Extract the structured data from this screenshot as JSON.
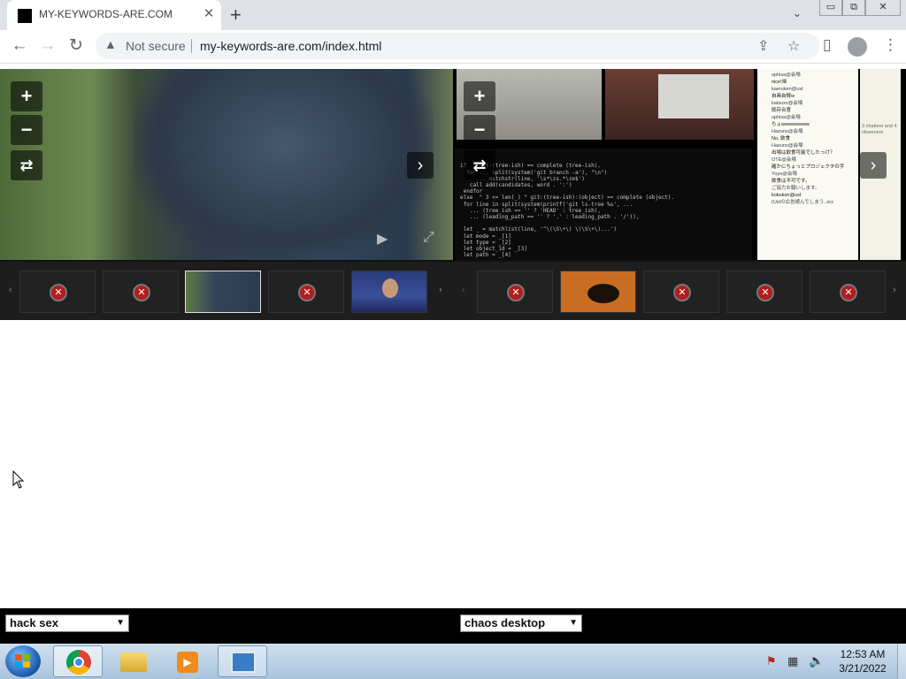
{
  "browser": {
    "tab_title": "MY-KEYWORDS-ARE.COM",
    "tab_close": "✕",
    "new_tab": "+",
    "window_minimize": "▭",
    "window_restore": "⧉",
    "window_close": "✕",
    "tab_search": "⌄",
    "back": "←",
    "forward": "→",
    "reload": "↻",
    "security_icon": "▲",
    "security_label": "Not secure",
    "url": "my-keywords-are.com/index.html",
    "share_icon": "⇪",
    "bookmark_icon": "☆",
    "sidepanel_icon": "▯",
    "menu_icon": "⋮"
  },
  "viewer": {
    "zoom_in": "+",
    "zoom_out": "−",
    "rotate": "⇄",
    "next": "›",
    "play": "▶",
    "fullscreen": "⤢",
    "strip_prev": "‹",
    "strip_next": "›",
    "thumb_error": "✕",
    "chat_header": "3 chatters and 4 observers",
    "chat_lines": [
      "uphisa@会場",
      "nice!帰",
      "kaeruken@ust",
      "自画自賛w",
      "katsuxx@会場",
      "既存合意",
      "uphisa@会場",
      "ちょwwwwwwww",
      "Hazuno@会場",
      "No, 飲食",
      "Hazuno@会場",
      "出場は飲食可能でしたっけ？",
      "OTE@会場",
      "確かにちょっとプロジェクタの字",
      "Yuyo@会場",
      "飲食は不可です。",
      "ご協力お願いします。",
      "kokukon@ust",
      "(Ustの広告読んでしまう..orz"
    ],
    "code_lines": [
      "if  \" git:(tree-ish) == complete (tree-ish).",
      "  for ... split(system('git branch -a'), \"\\n\")",
      "     ... matchstr(line, '\\s*\\zs.*\\ze$')",
      "   call add(candidates, word . ':')",
      " endfor",
      "else  \" 3 <= len(_) \" git:(tree-ish):(object) == complete (object).",
      " for line in split(system(printf('git ls-tree %s', ...",
      "   ... (tree_ish == '' ? 'HEAD' : tree_ish),",
      "   ... (leading_path == '' ? '.' : leading_path . '/')),",
      "",
      " let _ = matchlist(line, '^\\(\\S\\+\\) \\(\\S\\+\\)...')",
      " let mode = _[1]",
      " let type = _[2]",
      " let object_id = _[3]",
      " let path = _[4]",
      "",
      " let word = printf('%s:%s%s', ..."
    ]
  },
  "controls": {
    "left_select": "hack sex",
    "right_select": "chaos desktop"
  },
  "taskbar": {
    "time": "12:53 AM",
    "date": "3/21/2022"
  }
}
